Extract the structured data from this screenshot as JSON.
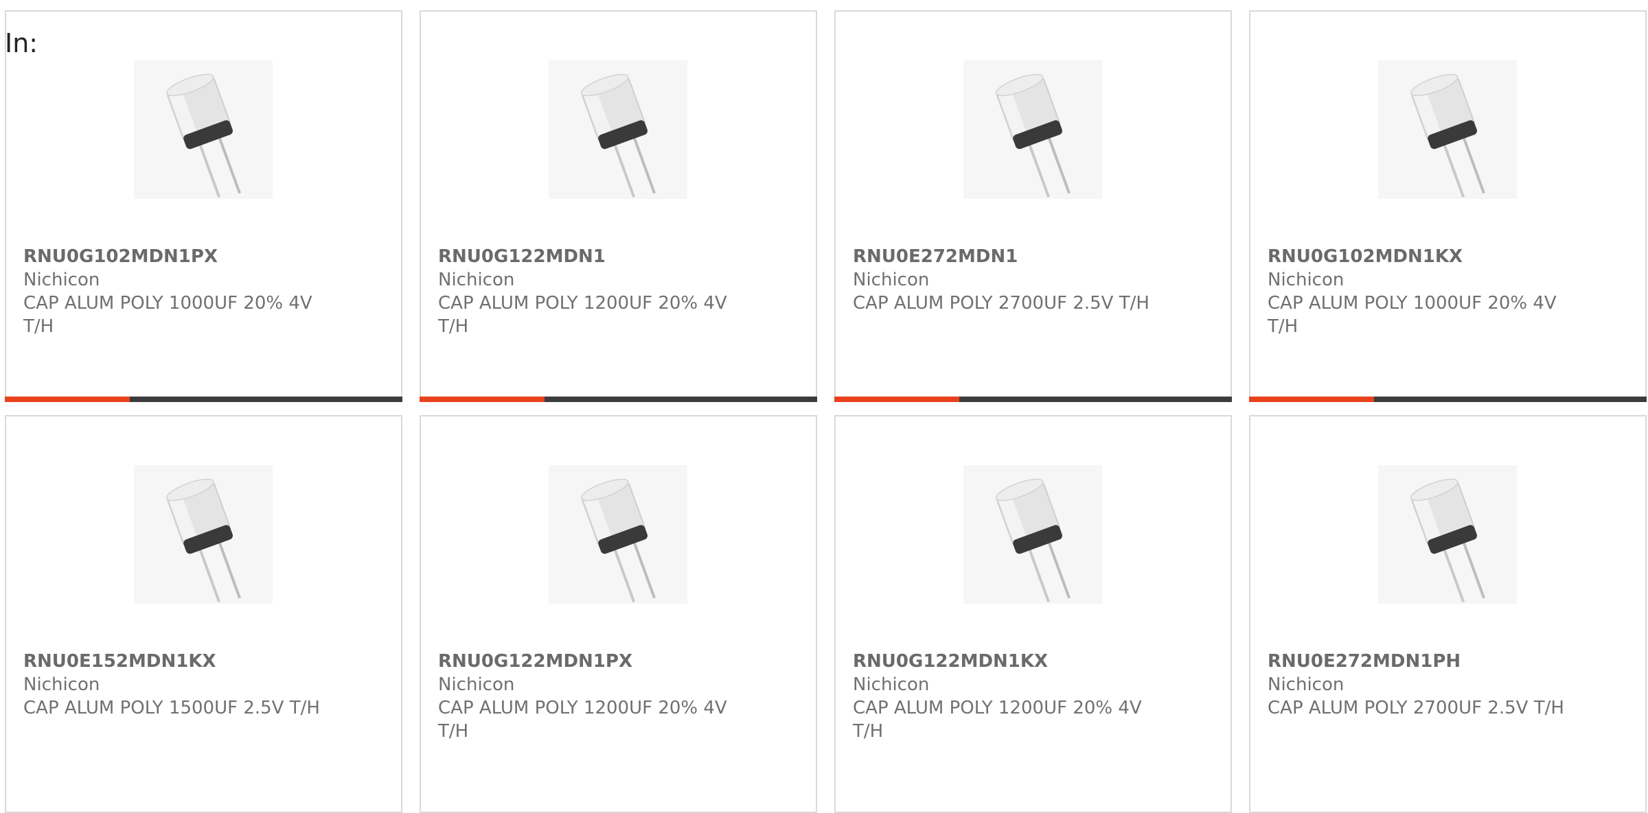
{
  "heading": "In:",
  "theme": {
    "accent": "#e8421c",
    "bar": "#3c3c3c",
    "border": "#d9d9d9",
    "text": "#707070"
  },
  "products": [
    {
      "part_number": "RNU0G102MDN1PX",
      "manufacturer": "Nichicon",
      "description": "CAP ALUM POLY 1000UF 20% 4V T/H",
      "image_icon": "capacitor-image",
      "highlight_fraction": 0.315
    },
    {
      "part_number": "RNU0G122MDN1",
      "manufacturer": "Nichicon",
      "description": "CAP ALUM POLY 1200UF 20% 4V T/H",
      "image_icon": "capacitor-image",
      "highlight_fraction": 0.315
    },
    {
      "part_number": "RNU0E272MDN1",
      "manufacturer": "Nichicon",
      "description": "CAP ALUM POLY 2700UF 2.5V T/H",
      "image_icon": "capacitor-image",
      "highlight_fraction": 0.315
    },
    {
      "part_number": "RNU0G102MDN1KX",
      "manufacturer": "Nichicon",
      "description": "CAP ALUM POLY 1000UF 20% 4V T/H",
      "image_icon": "capacitor-image",
      "highlight_fraction": 0.315
    },
    {
      "part_number": "RNU0E152MDN1KX",
      "manufacturer": "Nichicon",
      "description": "CAP ALUM POLY 1500UF 2.5V T/H",
      "image_icon": "capacitor-image"
    },
    {
      "part_number": "RNU0G122MDN1PX",
      "manufacturer": "Nichicon",
      "description": "CAP ALUM POLY 1200UF 20% 4V T/H",
      "image_icon": "capacitor-image"
    },
    {
      "part_number": "RNU0G122MDN1KX",
      "manufacturer": "Nichicon",
      "description": "CAP ALUM POLY 1200UF 20% 4V T/H",
      "image_icon": "capacitor-image"
    },
    {
      "part_number": "RNU0E272MDN1PH",
      "manufacturer": "Nichicon",
      "description": "CAP ALUM POLY 2700UF 2.5V T/H",
      "image_icon": "capacitor-image"
    }
  ]
}
